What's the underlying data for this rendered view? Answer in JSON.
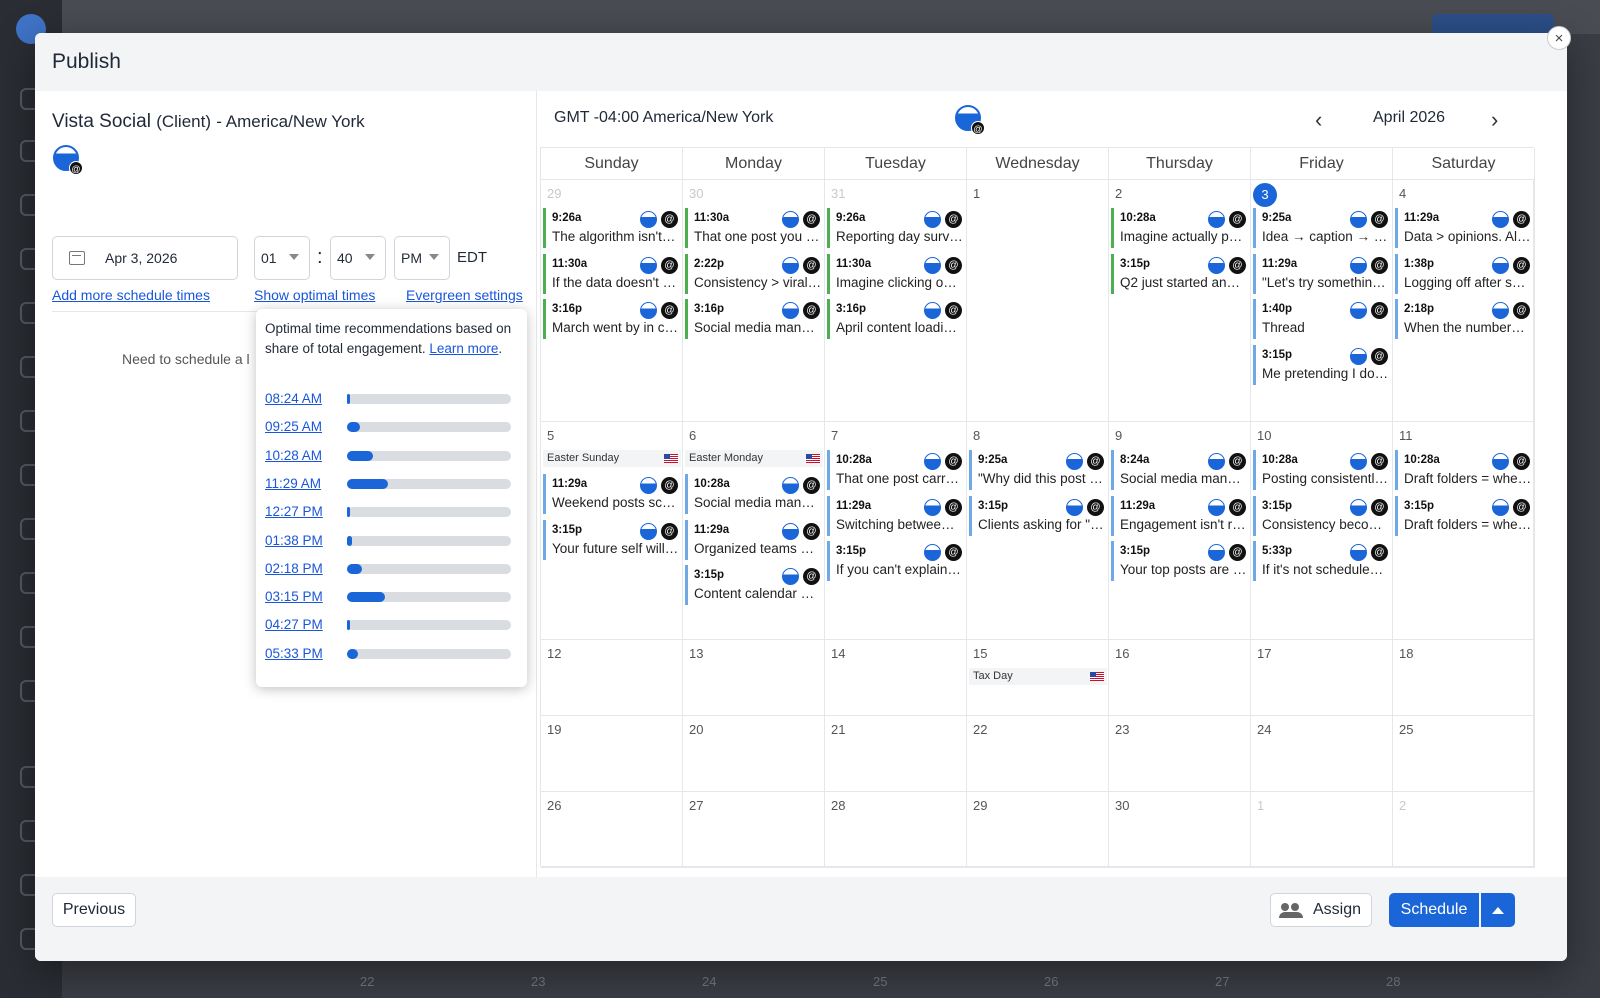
{
  "modal": {
    "title": "Publish",
    "close_glyph": "×"
  },
  "left": {
    "account_name": "Vista Social",
    "account_role": "(Client)",
    "account_tz": "- America/New York",
    "date": "Apr 3, 2026",
    "hour": "01",
    "minute": "40",
    "ampm": "PM",
    "tz_abbr": "EDT",
    "colon": ":",
    "add_times": "Add more schedule times",
    "show_optimal": "Show optimal times",
    "evergreen": "Evergreen settings",
    "need_schedule": "Need to schedule a l"
  },
  "popover": {
    "text": "Optimal time recommendations based on share of total engagement.",
    "learn_more": "Learn more",
    "period": ".",
    "times": [
      {
        "label": "08:24 AM",
        "share": 0.02
      },
      {
        "label": "09:25 AM",
        "share": 0.08
      },
      {
        "label": "10:28 AM",
        "share": 0.16
      },
      {
        "label": "11:29 AM",
        "share": 0.25
      },
      {
        "label": "12:27 PM",
        "share": 0.01
      },
      {
        "label": "01:38 PM",
        "share": 0.03
      },
      {
        "label": "02:18 PM",
        "share": 0.09
      },
      {
        "label": "03:15 PM",
        "share": 0.23
      },
      {
        "label": "04:27 PM",
        "share": 0.005
      },
      {
        "label": "05:33 PM",
        "share": 0.07
      }
    ]
  },
  "calendar": {
    "timezone": "GMT -04:00 America/New York",
    "month": "April 2026",
    "prev": "‹",
    "next": "›",
    "days": [
      "Sunday",
      "Monday",
      "Tuesday",
      "Wednesday",
      "Thursday",
      "Friday",
      "Saturday"
    ],
    "weeks": [
      [
        {
          "n": "29",
          "muted": true,
          "posts": [
            [
              "9:26a",
              "The algorithm isn't…",
              "g"
            ],
            [
              "11:30a",
              "If the data doesn't …",
              "g"
            ],
            [
              "3:16p",
              "March went by in c…",
              "g"
            ]
          ]
        },
        {
          "n": "30",
          "muted": true,
          "posts": [
            [
              "11:30a",
              "That one post you …",
              "g"
            ],
            [
              "2:22p",
              "Consistency > viral…",
              "g"
            ],
            [
              "3:16p",
              "Social media man…",
              "g"
            ]
          ]
        },
        {
          "n": "31",
          "muted": true,
          "posts": [
            [
              "9:26a",
              "Reporting day surv…",
              "g"
            ],
            [
              "11:30a",
              "Imagine clicking o…",
              "g"
            ],
            [
              "3:16p",
              "April content loadi…",
              "g"
            ]
          ]
        },
        {
          "n": "1",
          "posts": []
        },
        {
          "n": "2",
          "posts": [
            [
              "10:28a",
              "Imagine actually p…",
              "g"
            ],
            [
              "3:15p",
              "Q2 just started an…",
              "g"
            ]
          ]
        },
        {
          "n": "3",
          "today": true,
          "posts": [
            [
              "9:25a",
              "Idea → caption → …",
              "b"
            ],
            [
              "11:29a",
              "\"Let's try somethin…",
              "b"
            ],
            [
              "1:40p",
              "Thread",
              "b"
            ],
            [
              "3:15p",
              "Me pretending I do…",
              "b"
            ]
          ]
        },
        {
          "n": "4",
          "posts": [
            [
              "11:29a",
              "Data > opinions. Al…",
              "b"
            ],
            [
              "1:38p",
              "Logging off after s…",
              "b"
            ],
            [
              "2:18p",
              "When the number…",
              "b"
            ]
          ]
        }
      ],
      [
        {
          "n": "5",
          "holiday": "Easter Sunday",
          "posts": [
            [
              "11:29a",
              "Weekend posts sc…",
              "b"
            ],
            [
              "3:15p",
              "Your future self will…",
              "b"
            ]
          ]
        },
        {
          "n": "6",
          "holiday": "Easter Monday",
          "posts": [
            [
              "10:28a",
              "Social media man…",
              "b"
            ],
            [
              "11:29a",
              "Organized teams …",
              "b"
            ],
            [
              "3:15p",
              "Content calendar …",
              "b"
            ]
          ]
        },
        {
          "n": "7",
          "posts": [
            [
              "10:28a",
              "That one post carr…",
              "b"
            ],
            [
              "11:29a",
              "Switching betwee…",
              "b"
            ],
            [
              "3:15p",
              "If you can't explain…",
              "b"
            ]
          ]
        },
        {
          "n": "8",
          "posts": [
            [
              "9:25a",
              "\"Why did this post …",
              "b"
            ],
            [
              "3:15p",
              "Clients asking for \"…",
              "b"
            ]
          ]
        },
        {
          "n": "9",
          "posts": [
            [
              "8:24a",
              "Social media man…",
              "b"
            ],
            [
              "11:29a",
              "Engagement isn't r…",
              "b"
            ],
            [
              "3:15p",
              "Your top posts are …",
              "b"
            ]
          ]
        },
        {
          "n": "10",
          "posts": [
            [
              "10:28a",
              "Posting consistentl…",
              "b"
            ],
            [
              "3:15p",
              "Consistency beco…",
              "b"
            ],
            [
              "5:33p",
              "If it's not schedule…",
              "b"
            ]
          ]
        },
        {
          "n": "11",
          "posts": [
            [
              "10:28a",
              "Draft folders = whe…",
              "b"
            ],
            [
              "3:15p",
              "Draft folders = whe…",
              "b"
            ]
          ]
        }
      ],
      [
        {
          "n": "12",
          "posts": []
        },
        {
          "n": "13",
          "posts": []
        },
        {
          "n": "14",
          "posts": []
        },
        {
          "n": "15",
          "holiday": "Tax Day",
          "posts": []
        },
        {
          "n": "16",
          "posts": []
        },
        {
          "n": "17",
          "posts": []
        },
        {
          "n": "18",
          "posts": []
        }
      ],
      [
        {
          "n": "19",
          "posts": []
        },
        {
          "n": "20",
          "posts": []
        },
        {
          "n": "21",
          "posts": []
        },
        {
          "n": "22",
          "posts": []
        },
        {
          "n": "23",
          "posts": []
        },
        {
          "n": "24",
          "posts": []
        },
        {
          "n": "25",
          "posts": []
        }
      ],
      [
        {
          "n": "26",
          "posts": []
        },
        {
          "n": "27",
          "posts": []
        },
        {
          "n": "28",
          "posts": []
        },
        {
          "n": "29",
          "posts": []
        },
        {
          "n": "30",
          "posts": []
        },
        {
          "n": "1",
          "muted": true,
          "posts": []
        },
        {
          "n": "2",
          "muted": true,
          "posts": []
        }
      ]
    ]
  },
  "footer": {
    "previous": "Previous",
    "assign": "Assign",
    "schedule": "Schedule"
  },
  "background": {
    "week_numbers": [
      "22",
      "23",
      "24",
      "25",
      "26",
      "27",
      "28"
    ]
  },
  "colors": {
    "accent": "#1a66d9",
    "past_post": "#4caf50",
    "future_post": "#6ea8e6"
  },
  "icons": {
    "profile": "profile-avatar-icon",
    "network": "threads-icon"
  }
}
